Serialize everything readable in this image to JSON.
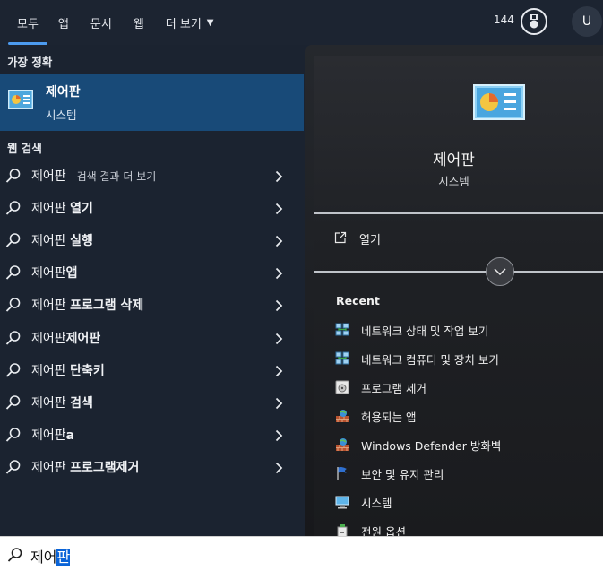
{
  "tabs": [
    {
      "label": "모두",
      "active": true
    },
    {
      "label": "앱"
    },
    {
      "label": "문서"
    },
    {
      "label": "웹"
    },
    {
      "label": "더 보기"
    }
  ],
  "header": {
    "points": "144",
    "avatar_initial": "U"
  },
  "left": {
    "best_match_title": "가장 정확",
    "best_match": {
      "name": "제어판",
      "type": "시스템"
    },
    "web_search_title": "웹 검색",
    "suggestions": [
      {
        "prefix": "제어판",
        "bold": "",
        "hint": " - 검색 결과 더 보기"
      },
      {
        "prefix": "제어판 ",
        "bold": "열기",
        "hint": ""
      },
      {
        "prefix": "제어판 ",
        "bold": "실행",
        "hint": ""
      },
      {
        "prefix": "제어판",
        "bold": "앱",
        "hint": ""
      },
      {
        "prefix": "제어판 ",
        "bold": "프로그램 삭제",
        "hint": ""
      },
      {
        "prefix": "제어판",
        "bold": "제어판",
        "hint": ""
      },
      {
        "prefix": "제어판 ",
        "bold": "단축키",
        "hint": ""
      },
      {
        "prefix": "제어판 ",
        "bold": "검색",
        "hint": ""
      },
      {
        "prefix": "제어판",
        "bold": "a",
        "hint": ""
      },
      {
        "prefix": "제어판 ",
        "bold": "프로그램제거",
        "hint": ""
      }
    ]
  },
  "right": {
    "app_name": "제어판",
    "app_type": "시스템",
    "open_label": "열기",
    "recent_title": "Recent",
    "recent": [
      {
        "label": "네트워크 상태 및 작업 보기",
        "icon": "network-icon"
      },
      {
        "label": "네트워크 컴퓨터 및 장치 보기",
        "icon": "network-icon"
      },
      {
        "label": "프로그램 제거",
        "icon": "programs-icon"
      },
      {
        "label": "허용되는 앱",
        "icon": "firewall-icon"
      },
      {
        "label": "Windows Defender 방화벽",
        "icon": "firewall-icon"
      },
      {
        "label": "보안 및 유지 관리",
        "icon": "flag-icon"
      },
      {
        "label": "시스템",
        "icon": "monitor-icon"
      },
      {
        "label": "전원 옵션",
        "icon": "power-icon"
      }
    ]
  },
  "search": {
    "typed": "제어",
    "selected": "판"
  },
  "colors": {
    "accent": "#4c9bf0",
    "highlight": "#184a78",
    "selection": "#0a64d8"
  }
}
